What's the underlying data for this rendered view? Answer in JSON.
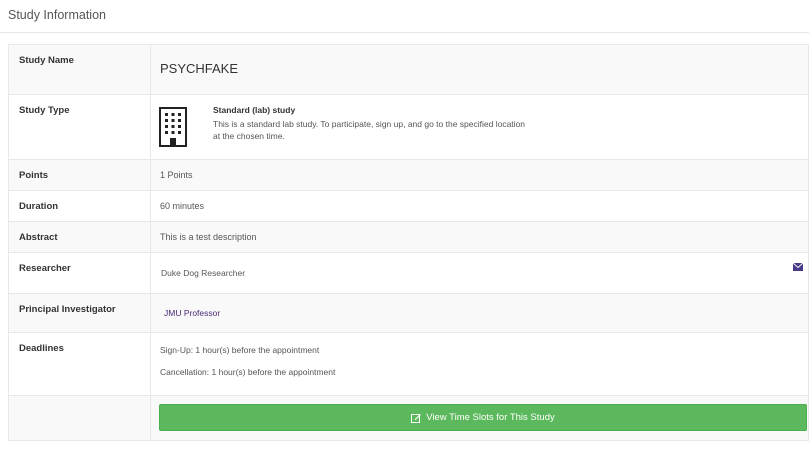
{
  "section": {
    "title": "Study Information"
  },
  "rows": {
    "study_name": {
      "label": "Study Name",
      "value": "PSYCHFAKE"
    },
    "study_type": {
      "label": "Study Type",
      "type_title": "Standard (lab) study",
      "type_desc": "This is a standard lab study. To participate, sign up, and go to the specified location at the chosen time.",
      "icon": "building-icon"
    },
    "points": {
      "label": "Points",
      "value": "1 Points"
    },
    "duration": {
      "label": "Duration",
      "value": "60 minutes"
    },
    "abstract": {
      "label": "Abstract",
      "value": "This is a test description"
    },
    "researcher": {
      "label": "Researcher",
      "value": "Duke Dog Researcher",
      "icon": "mail-icon"
    },
    "pi": {
      "label": "Principal Investigator",
      "value": "JMU Professor"
    },
    "deadlines": {
      "label": "Deadlines",
      "signup": "Sign-Up: 1 hour(s) before the appointment",
      "cancellation": "Cancellation: 1 hour(s) before the appointment"
    }
  },
  "action": {
    "label": "View Time Slots for This Study",
    "icon": "edit-icon",
    "color": "#5cb85c"
  },
  "colors": {
    "accent_link": "#4b2a7a",
    "mail_icon": "#4b3a8a"
  }
}
